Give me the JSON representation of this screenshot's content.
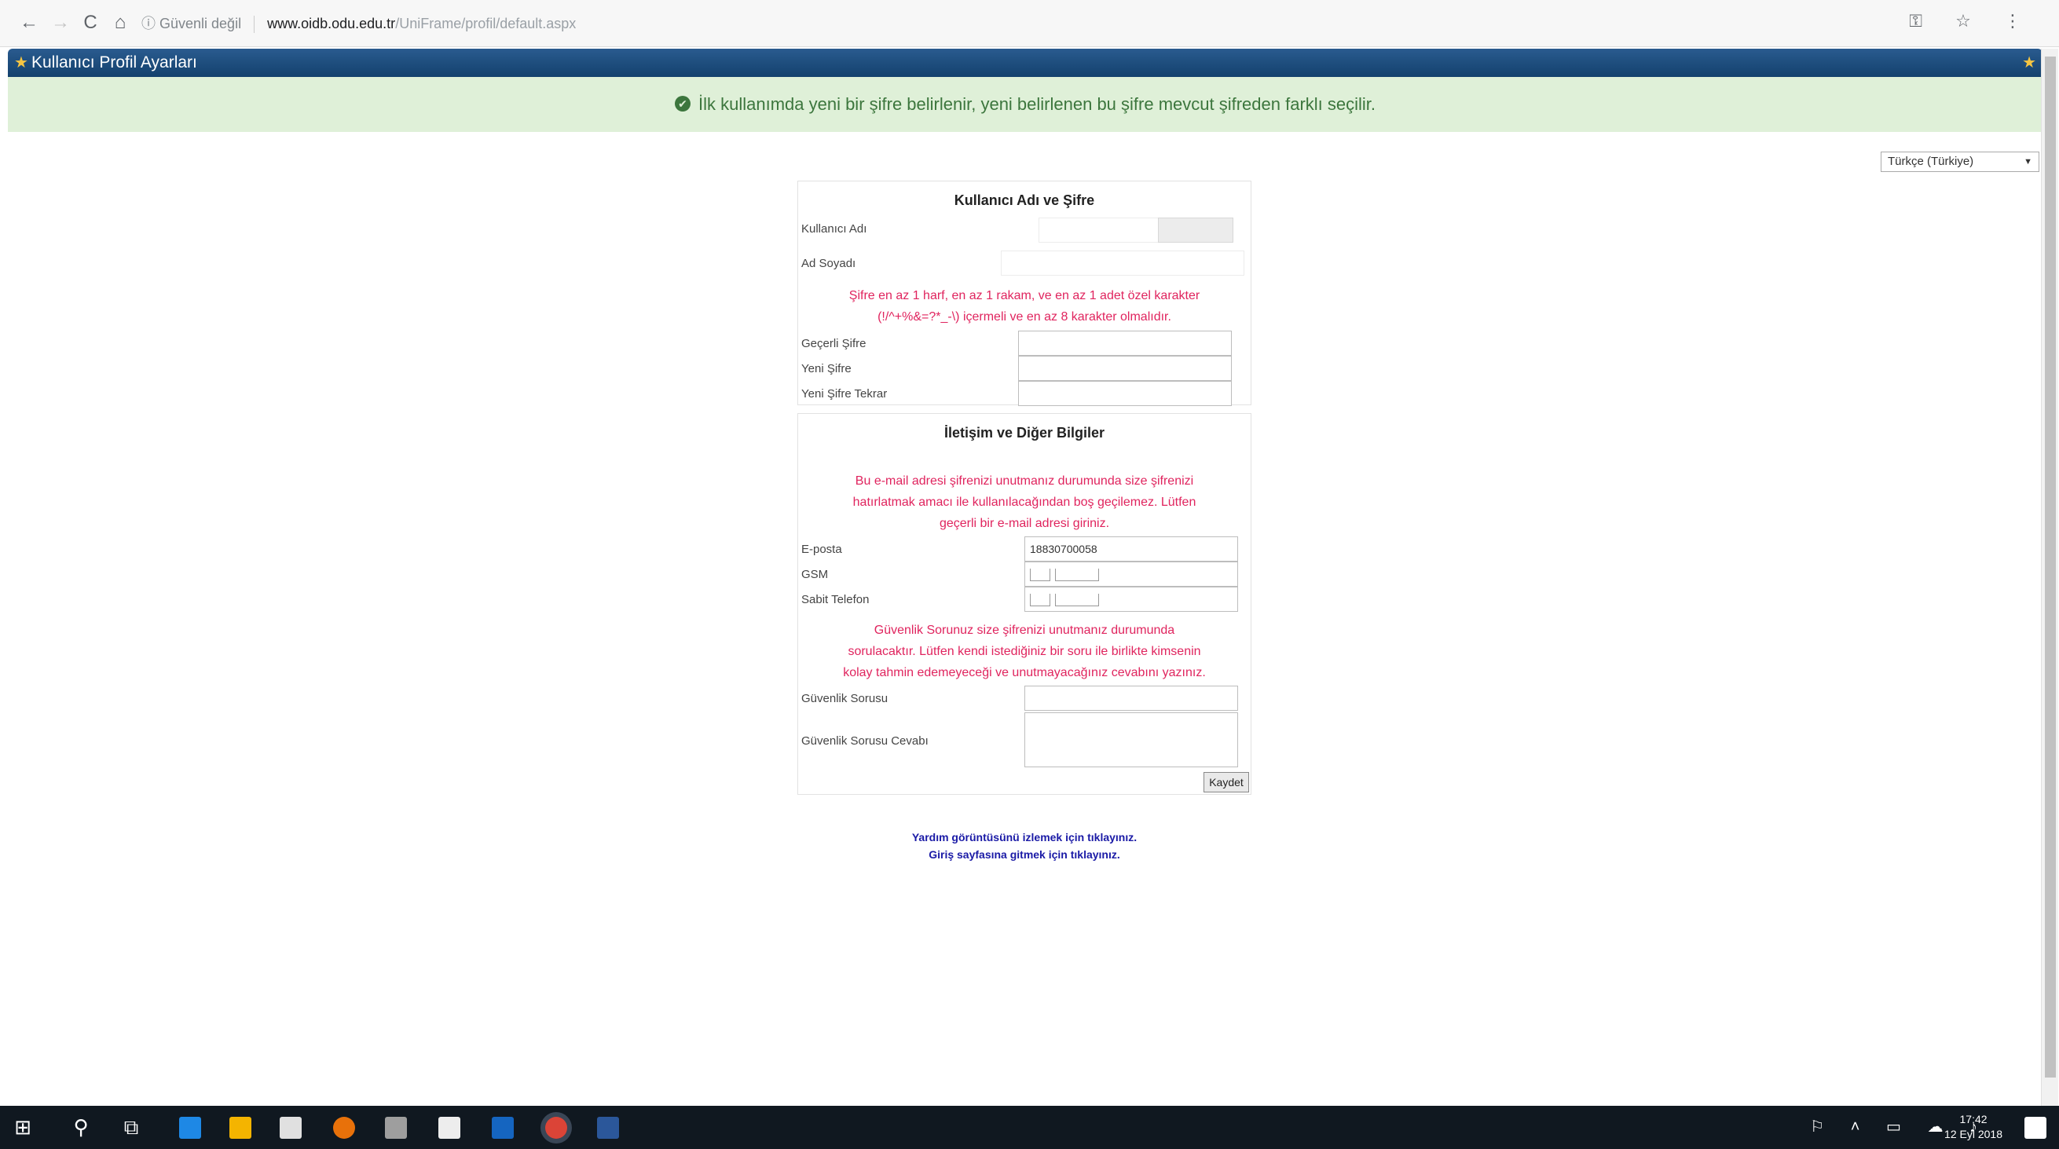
{
  "browser": {
    "back": "←",
    "forward": "→",
    "reload": "C",
    "home": "⌂",
    "security": "ⓘ Güvenli değil",
    "url_host": "www.oidb.odu.edu.tr",
    "url_path": "/UniFrame/profil/default.aspx",
    "right_icons": "⚿ ☆ ⋮"
  },
  "app": {
    "title": "Kullanıcı Profil Ayarları"
  },
  "banner": {
    "message": "İlk kullanımda yeni bir şifre belirlenir, yeni belirlenen bu şifre mevcut şifreden farklı seçilir."
  },
  "language": {
    "selected": "Türkçe (Türkiye)"
  },
  "credentials": {
    "title": "Kullanıcı Adı ve Şifre",
    "username_label": "Kullanıcı Adı",
    "fullname_label": "Ad Soyadı",
    "password_rule_1": "Şifre en az 1 harf, en az 1 rakam, ve en az 1 adet özel karakter",
    "password_rule_2": "(!/^+%&=?*_-\\) içermeli ve en az 8 karakter olmalıdır.",
    "current_password_label": "Geçerli Şifre",
    "new_password_label": "Yeni Şifre",
    "new_password_repeat_label": "Yeni Şifre Tekrar"
  },
  "contact": {
    "title": "İletişim ve Diğer Bilgiler",
    "email_note_1": "Bu e-mail adresi şifrenizi unutmanız durumunda size şifrenizi",
    "email_note_2": "hatırlatmak amacı ile kullanılacağından boş geçilemez. Lütfen",
    "email_note_3": "geçerli bir e-mail adresi giriniz.",
    "email_label": "E-posta",
    "email_value": "18830700058",
    "gsm_label": "GSM",
    "landline_label": "Sabit Telefon",
    "security_note_1": "Güvenlik Sorunuz size şifrenizi unutmanız durumunda",
    "security_note_2": "sorulacaktır. Lütfen kendi istediğiniz bir soru ile birlikte kimsenin",
    "security_note_3": "kolay tahmin edemeyeceği ve unutmayacağınız cevabını yazınız.",
    "security_question_label": "Güvenlik Sorusu",
    "security_answer_label": "Güvenlik Sorusu Cevabı",
    "save_label": "Kaydet"
  },
  "links": {
    "help": "Yardım görüntüsünü izlemek için tıklayınız.",
    "login": "Giriş sayfasına gitmek için tıklayınız."
  },
  "taskbar": {
    "time": "17:42",
    "date": "12 Eyl 2018"
  }
}
